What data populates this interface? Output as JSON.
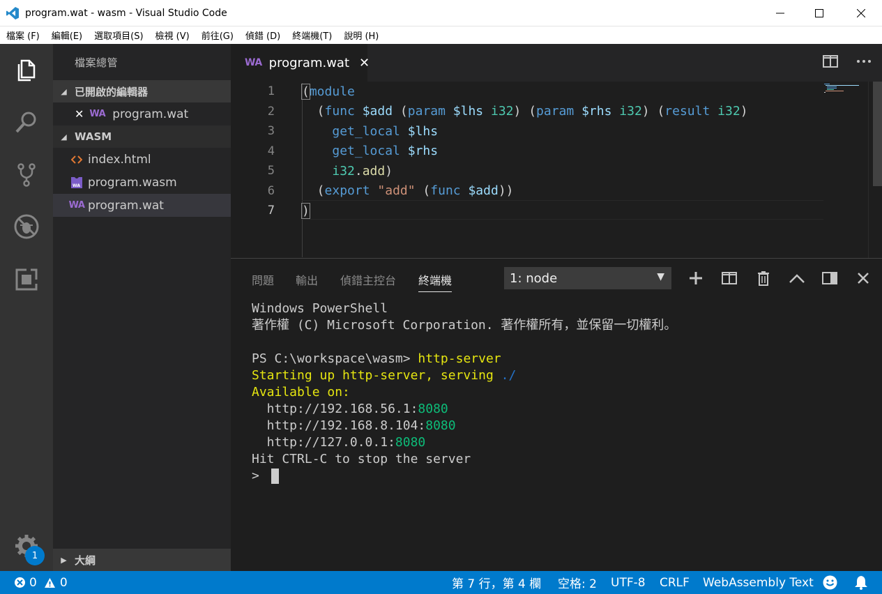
{
  "window": {
    "title": "program.wat - wasm - Visual Studio Code",
    "min_icon": "minimize-icon",
    "max_icon": "maximize-icon",
    "close_icon": "close-icon"
  },
  "menu": {
    "items": [
      "檔案 (F)",
      "編輯(E)",
      "選取項目(S)",
      "檢視 (V)",
      "前往(G)",
      "偵錯 (D)",
      "終端機(T)",
      "說明 (H)"
    ]
  },
  "activity_bar": {
    "icons": [
      "files-icon",
      "search-icon",
      "source-control-icon",
      "debug-icon",
      "extensions-icon",
      "gear-icon"
    ],
    "settings_badge": "1"
  },
  "sidebar": {
    "title": "檔案總管",
    "open_editors": {
      "header": "已開啟的編輯器",
      "items": [
        {
          "close": "✕",
          "icon_text": "WA",
          "label": "program.wat"
        }
      ]
    },
    "folder": {
      "header": "WASM",
      "items": [
        {
          "icon": "html-icon",
          "label": "index.html"
        },
        {
          "icon": "wasm-file-icon",
          "label": "program.wasm"
        },
        {
          "icon_text": "WA",
          "label": "program.wat"
        }
      ]
    },
    "outline": {
      "header": "大綱"
    }
  },
  "editor": {
    "tab": {
      "icon_text": "WA",
      "label": "program.wat",
      "close": "✕"
    },
    "actions": [
      "split-editor-icon",
      "more-icon"
    ],
    "lines": [
      {
        "n": "1",
        "tokens": [
          {
            "t": "(",
            "c": "tk-paren"
          },
          {
            "t": "module",
            "c": "tk-kw"
          }
        ]
      },
      {
        "n": "2",
        "tokens": [
          {
            "t": "  (",
            "c": "tk-paren"
          },
          {
            "t": "func",
            "c": "tk-kw"
          },
          {
            "t": " ",
            "c": "tk-plain"
          },
          {
            "t": "$add",
            "c": "tk-var"
          },
          {
            "t": " (",
            "c": "tk-paren"
          },
          {
            "t": "param",
            "c": "tk-kw"
          },
          {
            "t": " ",
            "c": "tk-plain"
          },
          {
            "t": "$lhs",
            "c": "tk-var"
          },
          {
            "t": " ",
            "c": "tk-plain"
          },
          {
            "t": "i32",
            "c": "tk-type"
          },
          {
            "t": ") (",
            "c": "tk-paren"
          },
          {
            "t": "param",
            "c": "tk-kw"
          },
          {
            "t": " ",
            "c": "tk-plain"
          },
          {
            "t": "$rhs",
            "c": "tk-var"
          },
          {
            "t": " ",
            "c": "tk-plain"
          },
          {
            "t": "i32",
            "c": "tk-type"
          },
          {
            "t": ") (",
            "c": "tk-paren"
          },
          {
            "t": "result",
            "c": "tk-kw"
          },
          {
            "t": " ",
            "c": "tk-plain"
          },
          {
            "t": "i32",
            "c": "tk-type"
          },
          {
            "t": ")",
            "c": "tk-paren"
          }
        ]
      },
      {
        "n": "3",
        "tokens": [
          {
            "t": "    ",
            "c": "tk-plain"
          },
          {
            "t": "get_local",
            "c": "tk-kw"
          },
          {
            "t": " ",
            "c": "tk-plain"
          },
          {
            "t": "$lhs",
            "c": "tk-var"
          }
        ]
      },
      {
        "n": "4",
        "tokens": [
          {
            "t": "    ",
            "c": "tk-plain"
          },
          {
            "t": "get_local",
            "c": "tk-kw"
          },
          {
            "t": " ",
            "c": "tk-plain"
          },
          {
            "t": "$rhs",
            "c": "tk-var"
          }
        ]
      },
      {
        "n": "5",
        "tokens": [
          {
            "t": "    ",
            "c": "tk-plain"
          },
          {
            "t": "i32",
            "c": "tk-type"
          },
          {
            "t": ".",
            "c": "tk-plain"
          },
          {
            "t": "add",
            "c": "tk-fn"
          },
          {
            "t": ")",
            "c": "tk-paren"
          }
        ]
      },
      {
        "n": "6",
        "tokens": [
          {
            "t": "  (",
            "c": "tk-paren"
          },
          {
            "t": "export",
            "c": "tk-kw"
          },
          {
            "t": " ",
            "c": "tk-plain"
          },
          {
            "t": "\"add\"",
            "c": "tk-str"
          },
          {
            "t": " (",
            "c": "tk-paren"
          },
          {
            "t": "func",
            "c": "tk-kw"
          },
          {
            "t": " ",
            "c": "tk-plain"
          },
          {
            "t": "$add",
            "c": "tk-var"
          },
          {
            "t": "))",
            "c": "tk-paren"
          }
        ]
      },
      {
        "n": "7",
        "tokens": [
          {
            "t": ")",
            "c": "tk-paren"
          }
        ]
      }
    ]
  },
  "panel": {
    "tabs": [
      "問題",
      "輸出",
      "偵錯主控台",
      "終端機"
    ],
    "active_tab": 3,
    "terminal_select": "1: node",
    "actions": [
      "plus-icon",
      "split-terminal-icon",
      "trash-icon",
      "chevron-up-icon",
      "panel-layout-icon",
      "close-panel-icon"
    ],
    "terminal_lines": [
      [
        {
          "t": "Windows PowerShell",
          "c": ""
        }
      ],
      [
        {
          "t": "著作權 (C) Microsoft Corporation. 著作權所有，並保留一切權利。",
          "c": ""
        }
      ],
      [
        {
          "t": "",
          "c": ""
        }
      ],
      [
        {
          "t": "PS C:\\workspace\\wasm> ",
          "c": ""
        },
        {
          "t": "http-server",
          "c": "t-yellow"
        }
      ],
      [
        {
          "t": "Starting up http-server, serving ",
          "c": "t-yellow"
        },
        {
          "t": "./",
          "c": "t-blue"
        }
      ],
      [
        {
          "t": "Available on:",
          "c": "t-yellow"
        }
      ],
      [
        {
          "t": "  http://192.168.56.1:",
          "c": ""
        },
        {
          "t": "8080",
          "c": "t-green"
        }
      ],
      [
        {
          "t": "  http://192.168.8.104:",
          "c": ""
        },
        {
          "t": "8080",
          "c": "t-green"
        }
      ],
      [
        {
          "t": "  http://127.0.0.1:",
          "c": ""
        },
        {
          "t": "8080",
          "c": "t-green"
        }
      ],
      [
        {
          "t": "Hit CTRL-C to stop the server",
          "c": ""
        }
      ],
      [
        {
          "t": "> ",
          "c": ""
        }
      ]
    ]
  },
  "statusbar": {
    "errors": "0",
    "warnings": "0",
    "position": "第 7 行，第 4 欄",
    "spaces": "空格: 2",
    "encoding": "UTF-8",
    "eol": "CRLF",
    "language": "WebAssembly Text"
  },
  "colors": {
    "accent": "#007acc",
    "activity_bar": "#333333",
    "sidebar": "#252526",
    "editor_bg": "#1e1e1e"
  }
}
